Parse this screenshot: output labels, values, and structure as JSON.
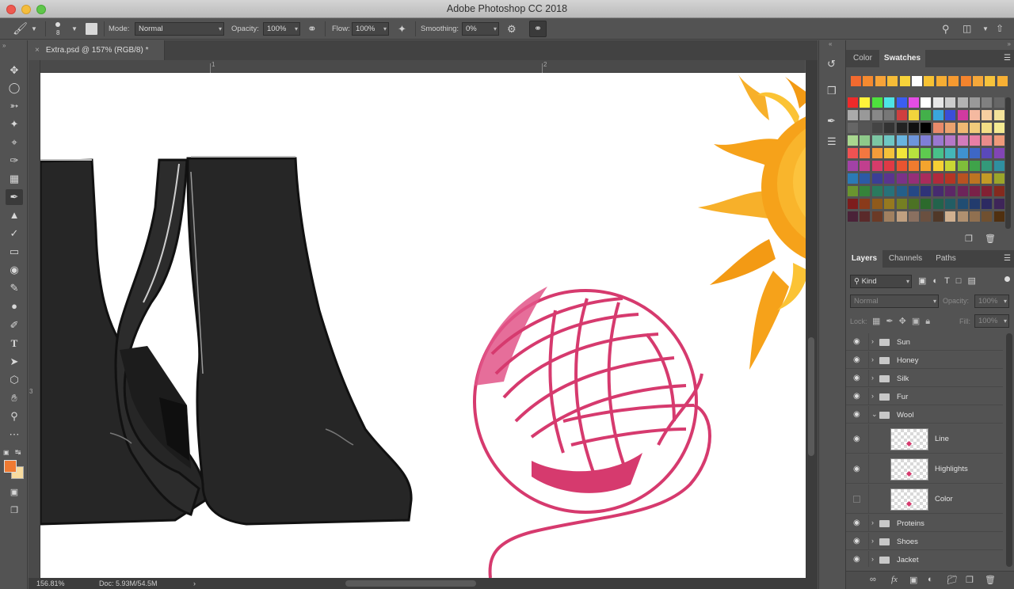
{
  "window": {
    "title": "Adobe Photoshop CC 2018"
  },
  "options_bar": {
    "brush_size": "8",
    "mode_label": "Mode:",
    "mode_value": "Normal",
    "opacity_label": "Opacity:",
    "opacity_value": "100%",
    "flow_label": "Flow:",
    "flow_value": "100%",
    "smoothing_label": "Smoothing:",
    "smoothing_value": "0%"
  },
  "document": {
    "tab_title": "Extra.psd @ 157% (RGB/8) *",
    "ruler_h": [
      "1",
      "2"
    ],
    "ruler_v": [
      "3"
    ]
  },
  "status": {
    "zoom": "156.81%",
    "doc_size": "Doc: 5.93M/54.5M"
  },
  "colors": {
    "foreground": "#f07a32",
    "background": "#f8dca0",
    "yarn": "#d63a6e",
    "boot": "#262626",
    "sun": "#f6a21a"
  },
  "tools": [
    "move-icon",
    "marquee-icon",
    "lasso-icon",
    "magic-wand-icon",
    "crop-icon",
    "eyedropper-icon",
    "healing-icon",
    "brush-icon",
    "stamp-icon",
    "history-brush-icon",
    "eraser-icon",
    "paint-bucket-icon",
    "smudge-icon",
    "dodge-icon",
    "pen-icon",
    "type-icon",
    "path-select-icon",
    "shape-icon",
    "hand-icon",
    "zoom-icon",
    "more-icon"
  ],
  "swatch_panel": {
    "tabs": [
      "Color",
      "Swatches"
    ],
    "active": "Swatches"
  },
  "layers_panel": {
    "tabs": [
      "Layers",
      "Channels",
      "Paths"
    ],
    "active": "Layers",
    "filter_kind": "Kind",
    "blend_mode": "Normal",
    "opacity_label": "Opacity:",
    "opacity_value": "100%",
    "lock_label": "Lock:",
    "fill_label": "Fill:",
    "fill_value": "100%",
    "layers": [
      {
        "name": "Sun",
        "type": "group",
        "expanded": false,
        "visible": true
      },
      {
        "name": "Honey",
        "type": "group",
        "expanded": false,
        "visible": true
      },
      {
        "name": "Silk",
        "type": "group",
        "expanded": false,
        "visible": true
      },
      {
        "name": "Fur",
        "type": "group",
        "expanded": false,
        "visible": true
      },
      {
        "name": "Wool",
        "type": "group",
        "expanded": true,
        "visible": true
      },
      {
        "name": "Line",
        "type": "layer",
        "visible": true
      },
      {
        "name": "Highlights",
        "type": "layer",
        "visible": true
      },
      {
        "name": "Color",
        "type": "layer",
        "visible": false
      },
      {
        "name": "Proteins",
        "type": "group",
        "expanded": false,
        "visible": true
      },
      {
        "name": "Shoes",
        "type": "group",
        "expanded": false,
        "visible": true
      },
      {
        "name": "Jacket",
        "type": "group",
        "expanded": false,
        "visible": true
      }
    ]
  }
}
